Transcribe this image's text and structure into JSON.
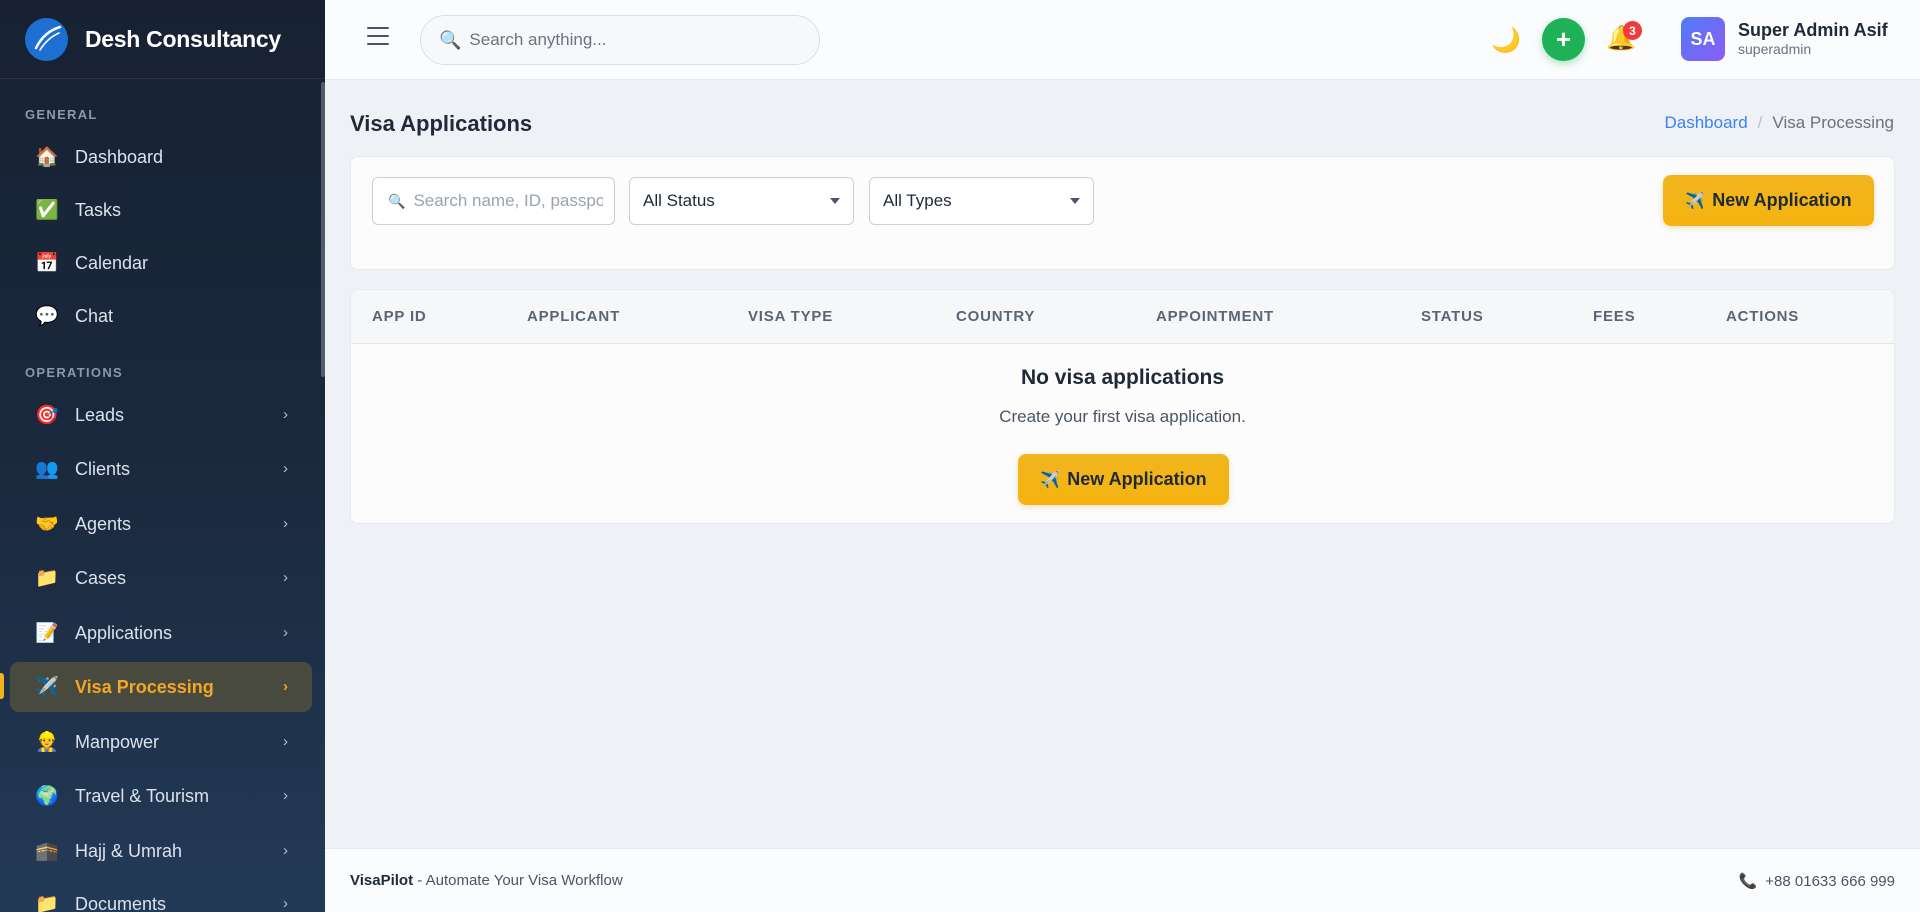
{
  "brand": {
    "name": "Desh Consultancy"
  },
  "sidebar": {
    "sections": [
      {
        "label": "GENERAL"
      },
      {
        "label": "OPERATIONS"
      }
    ],
    "items": [
      {
        "label": "Dashboard",
        "icon": "🏠"
      },
      {
        "label": "Tasks",
        "icon": "✅"
      },
      {
        "label": "Calendar",
        "icon": "📅"
      },
      {
        "label": "Chat",
        "icon": "💬"
      },
      {
        "label": "Leads",
        "icon": "🎯",
        "chevron": "›"
      },
      {
        "label": "Clients",
        "icon": "👥",
        "chevron": "›"
      },
      {
        "label": "Agents",
        "icon": "🤝",
        "chevron": "›"
      },
      {
        "label": "Cases",
        "icon": "📁",
        "chevron": "›"
      },
      {
        "label": "Applications",
        "icon": "📝",
        "chevron": "›"
      },
      {
        "label": "Visa Processing",
        "icon": "✈️",
        "chevron": "›",
        "active": true
      },
      {
        "label": "Manpower",
        "icon": "👷",
        "chevron": "›"
      },
      {
        "label": "Travel & Tourism",
        "icon": "🌍",
        "chevron": "›"
      },
      {
        "label": "Hajj & Umrah",
        "icon": "🕋",
        "chevron": "›"
      },
      {
        "label": "Documents",
        "icon": "📁",
        "chevron": "›"
      }
    ]
  },
  "header": {
    "search_placeholder": "Search anything...",
    "search_icon": "🔍",
    "theme_icon": "🌙",
    "add_icon": "+",
    "bell_icon": "🔔",
    "notification_count": "3",
    "user": {
      "initials": "SA",
      "name": "Super Admin Asif",
      "role": "superadmin"
    }
  },
  "page": {
    "title": "Visa Applications",
    "breadcrumb": {
      "home": "Dashboard",
      "separator": "/",
      "current": "Visa Processing"
    }
  },
  "filters": {
    "search_placeholder": "Search name, ID, passport...",
    "search_icon": "🔍",
    "status_value": "All Status",
    "type_value": "All Types",
    "new_button_icon": "✈️",
    "new_button_label": "New Application"
  },
  "table": {
    "columns": [
      "APP ID",
      "APPLICANT",
      "VISA TYPE",
      "COUNTRY",
      "APPOINTMENT",
      "STATUS",
      "FEES",
      "ACTIONS"
    ],
    "empty_title": "No visa applications",
    "empty_subtitle": "Create your first visa application.",
    "empty_button_icon": "✈️",
    "empty_button_label": "New Application"
  },
  "footer": {
    "brand": "VisaPilot",
    "tagline": " - Automate Your Visa Workflow",
    "phone_icon": "📞",
    "phone": "+88 01633 666 999"
  },
  "colors": {
    "accent": "#f5b21f",
    "sidebar_bg": "#1b2a3f",
    "success": "#1eb157",
    "link": "#3b82f6",
    "danger": "#ef3b3b"
  }
}
